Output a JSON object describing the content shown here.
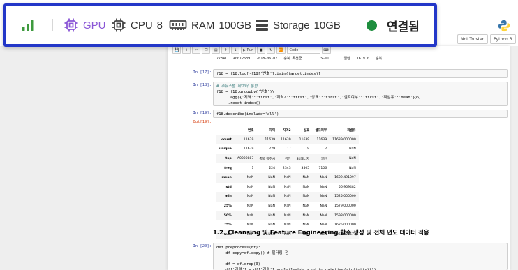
{
  "status_bar": {
    "signal_icon": "signal-bars-icon",
    "gpu": {
      "icon": "chip-icon",
      "label": "GPU",
      "color": "#8a56d6"
    },
    "cpu": {
      "icon": "chip-icon",
      "label": "CPU",
      "value": "8"
    },
    "ram": {
      "icon": "memory-icon",
      "label": "RAM",
      "value": "100GB"
    },
    "storage": {
      "icon": "storage-icon",
      "label": "Storage",
      "value": "10GB"
    },
    "connection": {
      "label": "연결됨",
      "color": "#1e8e3e"
    },
    "border_color": "#2337c8"
  },
  "jupyter": {
    "not_trusted": "Not Trusted",
    "kernel": "Python 3",
    "toolbar": {
      "run_label": "Run",
      "cell_type": "Code"
    },
    "prev_output_row": "77341   A0012639   2018-06-07   충북 옥천군         S-OIL      일반   1619.0   충북",
    "cells": [
      {
        "prompt": "In [17]:",
        "code": "f18 = f18.loc[~f18['번호'].isin(target.index)]"
      },
      {
        "prompt": "In [18]:",
        "comment": "# 주유소별 데이터 통합",
        "code": "f18 = f18.groupby('번호')\\\n     .agg({'지역':'first','지역2':'first','상표':'first','셀프여부':'first','휘발유':'mean'})\\\n     .reset_index()"
      },
      {
        "prompt": "In [19]:",
        "code": "f18.describe(include='all')"
      },
      {
        "prompt": "In [20]:",
        "code": "def preprocess(df):\n    df_copy=df.copy() # 필터링 전\n\n    df = df.drop(0)\n    df['가격'] = df['가격'].apply(lambda x:pd.to_datetime(str(int(x))))"
      }
    ],
    "out_prompt": "Out[19]:",
    "describe_table": {
      "columns": [
        "번호",
        "지역",
        "지역2",
        "상표",
        "셀프여부",
        "휘발유"
      ],
      "rows": [
        {
          "index": "count",
          "values": [
            "11639",
            "11639",
            "11639",
            "11639",
            "11639",
            "11639.000000"
          ]
        },
        {
          "index": "unique",
          "values": [
            "11639",
            "229",
            "17",
            "9",
            "2",
            "NaN"
          ]
        },
        {
          "index": "top",
          "values": [
            "A0000887",
            "충북 청주시",
            "경기",
            "SK에너지",
            "일반",
            "NaN"
          ]
        },
        {
          "index": "freq",
          "values": [
            "1",
            "224",
            "2343",
            "3505",
            "7106",
            "NaN"
          ]
        },
        {
          "index": "mean",
          "values": [
            "NaN",
            "NaN",
            "NaN",
            "NaN",
            "NaN",
            "1609.491097"
          ]
        },
        {
          "index": "std",
          "values": [
            "NaN",
            "NaN",
            "NaN",
            "NaN",
            "NaN",
            "56.959482"
          ]
        },
        {
          "index": "min",
          "values": [
            "NaN",
            "NaN",
            "NaN",
            "NaN",
            "NaN",
            "1525.000000"
          ]
        },
        {
          "index": "25%",
          "values": [
            "NaN",
            "NaN",
            "NaN",
            "NaN",
            "NaN",
            "1579.000000"
          ]
        },
        {
          "index": "50%",
          "values": [
            "NaN",
            "NaN",
            "NaN",
            "NaN",
            "NaN",
            "1598.000000"
          ]
        },
        {
          "index": "75%",
          "values": [
            "NaN",
            "NaN",
            "NaN",
            "NaN",
            "NaN",
            "1625.000000"
          ]
        },
        {
          "index": "max",
          "values": [
            "NaN",
            "NaN",
            "NaN",
            "NaN",
            "NaN",
            "2261.428571"
          ]
        }
      ]
    },
    "section_heading": "1.2. Cleansing 및 Feature Engineering 함수 생성 및 전체 년도 데이터 적용"
  }
}
